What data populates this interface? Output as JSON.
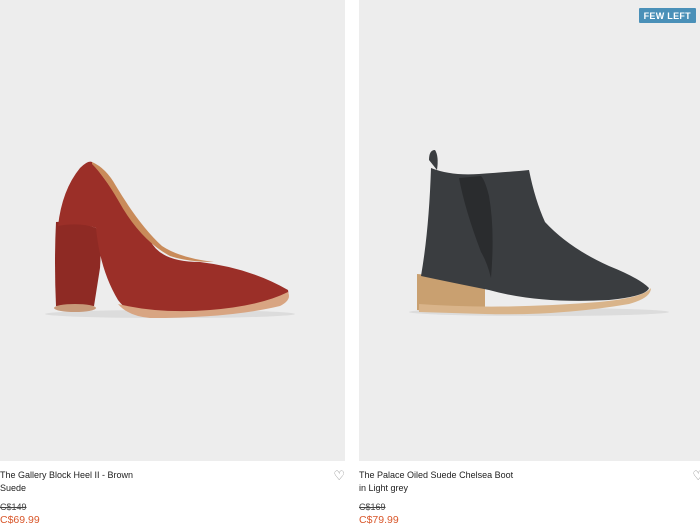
{
  "products": [
    {
      "name": "The Gallery Block Heel II - Brown Suede",
      "original_price": "C$149",
      "sale_price": "C$69.99",
      "badge": "",
      "wishlist_icon": "heart-outline-icon"
    },
    {
      "name": "The Palace Oiled Suede Chelsea Boot in Light grey",
      "original_price": "C$169",
      "sale_price": "C$79.99",
      "badge": "FEW LEFT",
      "wishlist_icon": "heart-outline-icon"
    }
  ],
  "colors": {
    "sale_price": "#d9572b",
    "badge_bg": "#4a90b8",
    "photo_bg": "#ededed"
  }
}
